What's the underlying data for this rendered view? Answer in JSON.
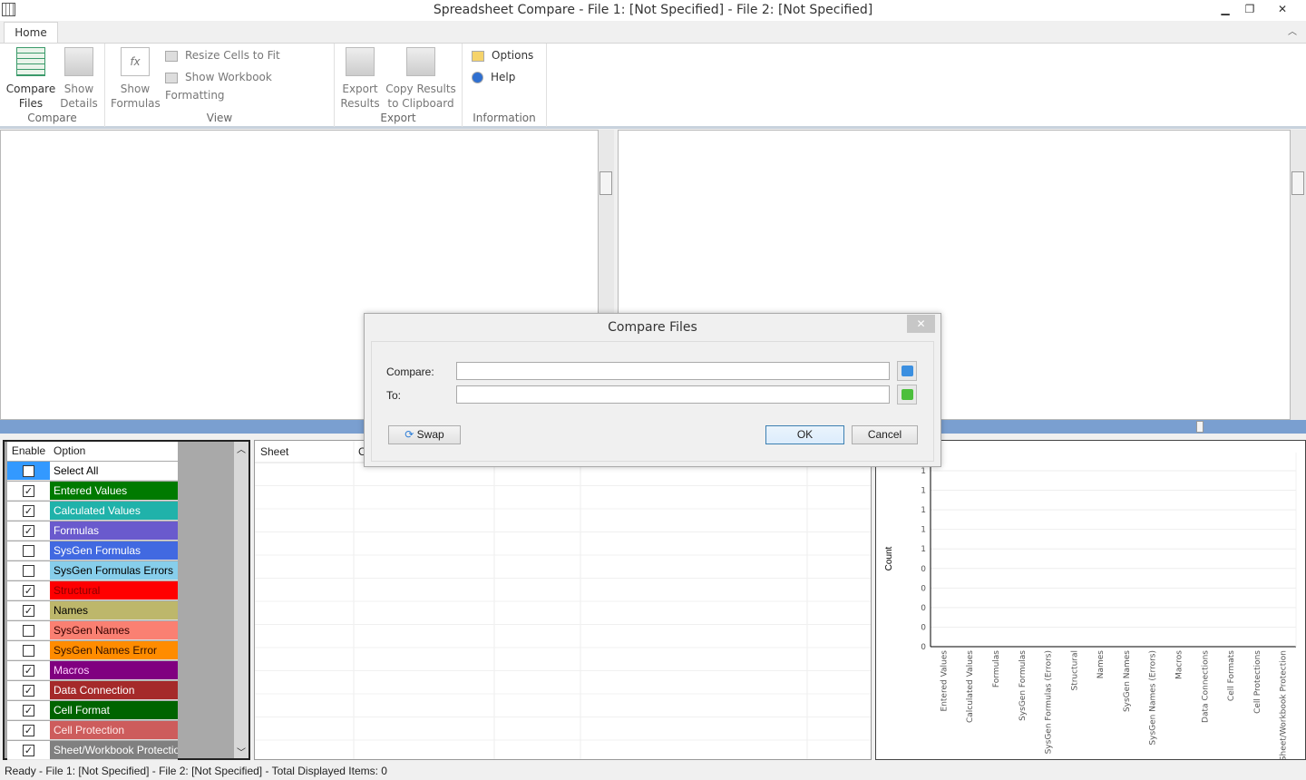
{
  "window": {
    "title": "Spreadsheet Compare - File 1: [Not Specified] - File 2: [Not Specified]",
    "minimize": "▁",
    "restore": "❐",
    "close": "✕"
  },
  "ribbon": {
    "tab": "Home",
    "groups": {
      "compare": {
        "label": "Compare",
        "compare_files": "Compare\nFiles",
        "show_details": "Show\nDetails"
      },
      "view": {
        "label": "View",
        "show_formulas": "Show\nFormulas",
        "resize_cells": "Resize Cells to Fit",
        "show_workbook_formatting": "Show Workbook Formatting"
      },
      "export": {
        "label": "Export",
        "export_results": "Export\nResults",
        "copy_results": "Copy Results\nto Clipboard"
      },
      "information": {
        "label": "Information",
        "options": "Options",
        "help": "Help"
      }
    }
  },
  "options": {
    "headers": {
      "enable": "Enable",
      "option": "Option"
    },
    "items": [
      {
        "label": "Select All",
        "checked": false,
        "color": "#ffffff",
        "text": "#000000"
      },
      {
        "label": "Entered Values",
        "checked": true,
        "color": "#007a00",
        "text": "#ffffff"
      },
      {
        "label": "Calculated Values",
        "checked": true,
        "color": "#20b2aa",
        "text": "#ffffff"
      },
      {
        "label": "Formulas",
        "checked": true,
        "color": "#6a5acd",
        "text": "#ffffff"
      },
      {
        "label": "SysGen Formulas",
        "checked": false,
        "color": "#4169e1",
        "text": "#ffffff"
      },
      {
        "label": "SysGen Formulas Errors",
        "checked": false,
        "color": "#87ceeb",
        "text": "#000000"
      },
      {
        "label": "Structural",
        "checked": true,
        "color": "#ff0000",
        "text": "#8b0000"
      },
      {
        "label": "Names",
        "checked": true,
        "color": "#bdb76b",
        "text": "#000000"
      },
      {
        "label": "SysGen Names",
        "checked": false,
        "color": "#fa8072",
        "text": "#330000"
      },
      {
        "label": "SysGen Names Error",
        "checked": false,
        "color": "#ff8c00",
        "text": "#331100"
      },
      {
        "label": "Macros",
        "checked": true,
        "color": "#800080",
        "text": "#ffd0ff"
      },
      {
        "label": "Data Connection",
        "checked": true,
        "color": "#a52a2a",
        "text": "#ffffff"
      },
      {
        "label": "Cell Format",
        "checked": true,
        "color": "#006400",
        "text": "#ffffff"
      },
      {
        "label": "Cell Protection",
        "checked": true,
        "color": "#cd5c5c",
        "text": "#ffe8e8"
      },
      {
        "label": "Sheet/Workbook Protection",
        "checked": true,
        "color": "#808080",
        "text": "#ffffff"
      }
    ]
  },
  "grid": {
    "columns": [
      "Sheet",
      "C"
    ]
  },
  "chart_data": {
    "type": "bar",
    "ylabel": "Count",
    "xlabel": "",
    "title": "",
    "ytick_labels": [
      "1",
      "1",
      "1",
      "1",
      "1",
      "0",
      "0",
      "0",
      "0",
      "0"
    ],
    "categories": [
      "Entered Values",
      "Calculated Values",
      "Formulas",
      "SysGen Formulas",
      "SysGen Formulas (Errors)",
      "Structural",
      "Names",
      "SysGen Names",
      "SysGen Names (Errors)",
      "Macros",
      "Data Connections",
      "Cell Formats",
      "Cell Protections",
      "Sheet/Workbook Protection"
    ],
    "values": [
      0,
      0,
      0,
      0,
      0,
      0,
      0,
      0,
      0,
      0,
      0,
      0,
      0,
      0
    ],
    "grid": true
  },
  "dialog": {
    "title": "Compare Files",
    "close": "✕",
    "compare_label": "Compare:",
    "to_label": "To:",
    "compare_value": "",
    "to_value": "",
    "swap": "Swap",
    "ok": "OK",
    "cancel": "Cancel"
  },
  "status": "Ready - File 1: [Not Specified] - File 2: [Not Specified] - Total Displayed Items: 0"
}
